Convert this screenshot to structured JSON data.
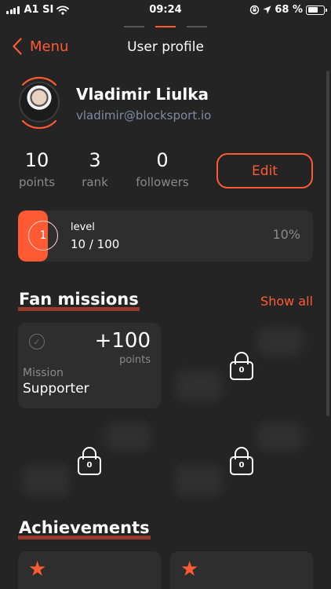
{
  "status_bar": {
    "carrier": "A1 SI",
    "time": "09:24",
    "battery": "68 %",
    "battery_level": 0.68
  },
  "nav": {
    "back_label": "Menu",
    "title": "User profile"
  },
  "profile": {
    "name": "Vladimir Liulka",
    "email": "vladimir@blocksport.io"
  },
  "stats": [
    {
      "value": "10",
      "label": "points"
    },
    {
      "value": "3",
      "label": "rank"
    },
    {
      "value": "0",
      "label": "followers"
    }
  ],
  "edit_label": "Edit",
  "level": {
    "number": "1",
    "label": "level",
    "progress": "10 / 100",
    "percent_text": "10%",
    "fraction": 0.1
  },
  "fan_missions": {
    "title": "Fan missions",
    "show_all": "Show all",
    "mission": {
      "points": "+100",
      "points_label": "points",
      "type": "Mission",
      "name": "Supporter"
    },
    "locked_counts": [
      "0",
      "0",
      "0"
    ]
  },
  "achievements": {
    "title": "Achievements"
  },
  "colors": {
    "accent": "#ff5a33",
    "background": "#242424",
    "card": "#2e2e2e",
    "email": "#7e8aa3"
  },
  "icons": [
    "signal-icon",
    "wifi-icon",
    "orientation-lock-icon",
    "location-icon",
    "battery-icon",
    "back-chevron-icon",
    "check-circle-icon",
    "lock-icon",
    "star-icon"
  ]
}
